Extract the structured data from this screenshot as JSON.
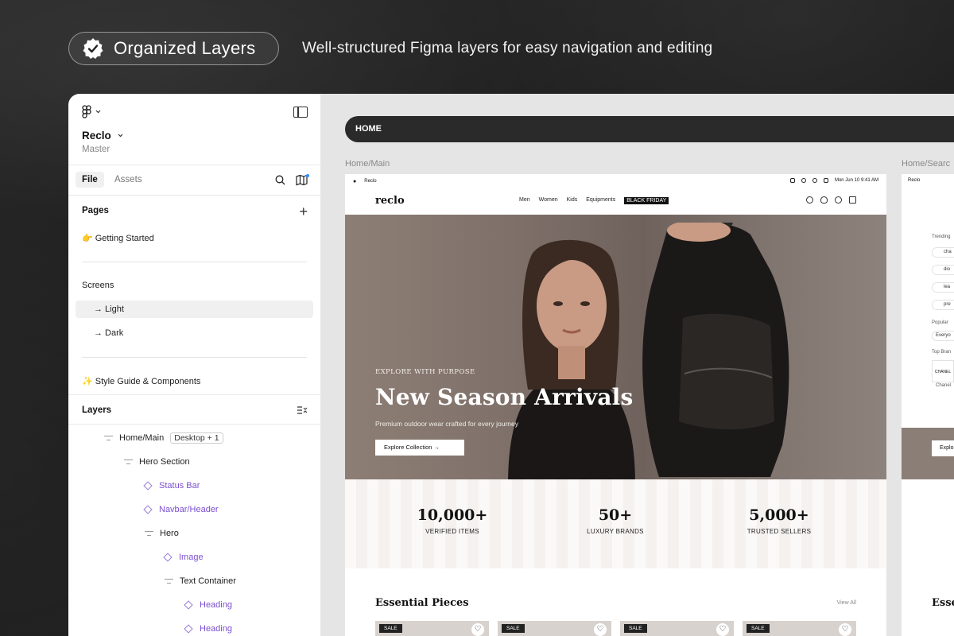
{
  "badge": {
    "label": "Organized Layers",
    "icon": "check-badge-icon"
  },
  "tagline": "Well-structured Figma layers for easy navigation and editing",
  "panel": {
    "project_name": "Reclo",
    "project_sub": "Master",
    "tabs": {
      "file": "File",
      "assets": "Assets"
    },
    "pages_title": "Pages",
    "pages": [
      "👉 Getting Started"
    ],
    "screens_title": "Screens",
    "screens": [
      "→ Light",
      "→ Dark"
    ],
    "style_guide": "✨ Style Guide & Components",
    "layers_title": "Layers",
    "layers": [
      {
        "label": "Home/Main",
        "chip": "Desktop + 1",
        "type": "frame",
        "indent": 0
      },
      {
        "label": "Hero Section",
        "type": "frame",
        "indent": 1
      },
      {
        "label": "Status Bar",
        "type": "component",
        "indent": 2
      },
      {
        "label": "Navbar/Header",
        "type": "component",
        "indent": 2
      },
      {
        "label": "Hero",
        "type": "frame",
        "indent": 2
      },
      {
        "label": "Image",
        "type": "component",
        "indent": 3
      },
      {
        "label": "Text Container",
        "type": "frame",
        "indent": 3
      },
      {
        "label": "Heading",
        "type": "component",
        "indent": 4
      },
      {
        "label": "Heading",
        "type": "component",
        "indent": 4
      }
    ]
  },
  "canvas": {
    "home_pill": "HOME",
    "frame1_label": "Home/Main",
    "frame2_label": "Home/Searc",
    "screen": {
      "status_left": "Reclo",
      "status_right": "Mon Jun 10  9:41 AM",
      "logo": "reclo",
      "nav": [
        "Men",
        "Women",
        "Kids",
        "Equipments"
      ],
      "nav_highlight": "BLACK FRIDAY",
      "hero_kicker": "EXPLORE WITH PURPOSE",
      "hero_title": "New Season Arrivals",
      "hero_sub": "Premium outdoor wear crafted for every journey",
      "hero_button": "Explore Collection  →",
      "stats": [
        {
          "num": "10,000+",
          "label": "VERIFIED ITEMS"
        },
        {
          "num": "50+",
          "label": "LUXURY BRANDS"
        },
        {
          "num": "5,000+",
          "label": "TRUSTED SELLERS"
        }
      ],
      "essentials_title": "Essential Pieces",
      "view_all": "View All",
      "sale_label": "SALE"
    },
    "screen2": {
      "status_left": "Reclo",
      "trending": "Trending",
      "items": [
        "cha",
        "dio",
        "lea",
        "pre"
      ],
      "popular": "Popular",
      "popular_chip": "Everyo",
      "top_brands": "Top Bran",
      "brand_name": "Chanel",
      "brand_logo": "CHANEL",
      "button": "Explo",
      "essentials": "Esse"
    }
  }
}
